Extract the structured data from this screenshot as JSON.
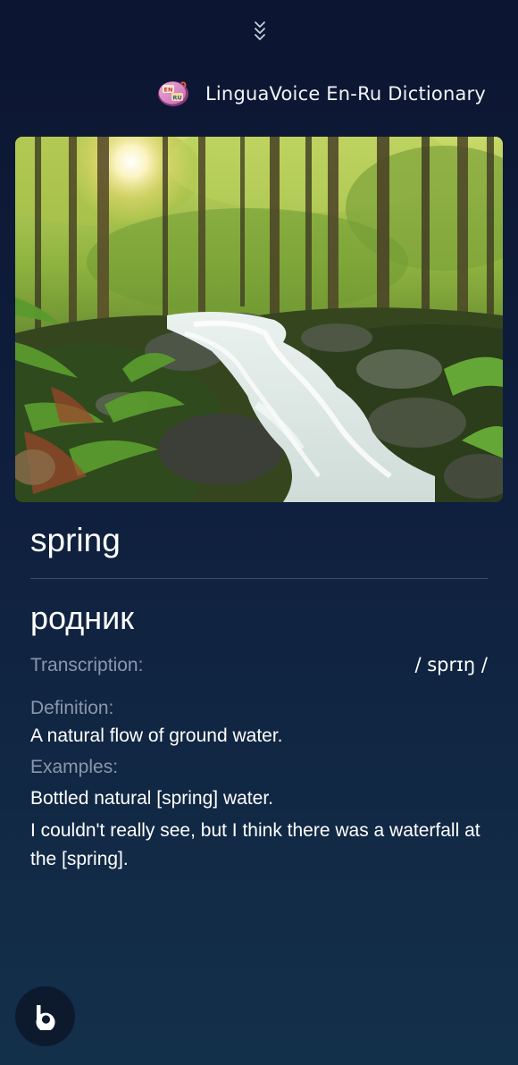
{
  "header": {
    "collapse_icon": "chevron-triple-down-icon",
    "app_icon": "linguavoice-app-icon",
    "app_icon_text_top": "EN",
    "app_icon_text_bottom": "RU",
    "app_title": "LinguaVoice En-Ru Dictionary"
  },
  "entry": {
    "image_subject": "forest stream",
    "word": "spring",
    "translation": "родник",
    "transcription_label": "Transcription:",
    "transcription": "/ sprɪŋ /",
    "definition_label": "Definition:",
    "definition": "A natural flow of ground water.",
    "examples_label": "Examples:",
    "examples": [
      "Bottled natural [spring] water.",
      "I couldn't really see, but I think there was a waterfall at the [spring]."
    ]
  },
  "footer": {
    "assistant_icon": "bixby-icon"
  },
  "colors": {
    "background_top": "#0c1531",
    "background_bottom": "#13304b",
    "label_gray": "#8a97ad",
    "divider": "#3b4c66"
  }
}
